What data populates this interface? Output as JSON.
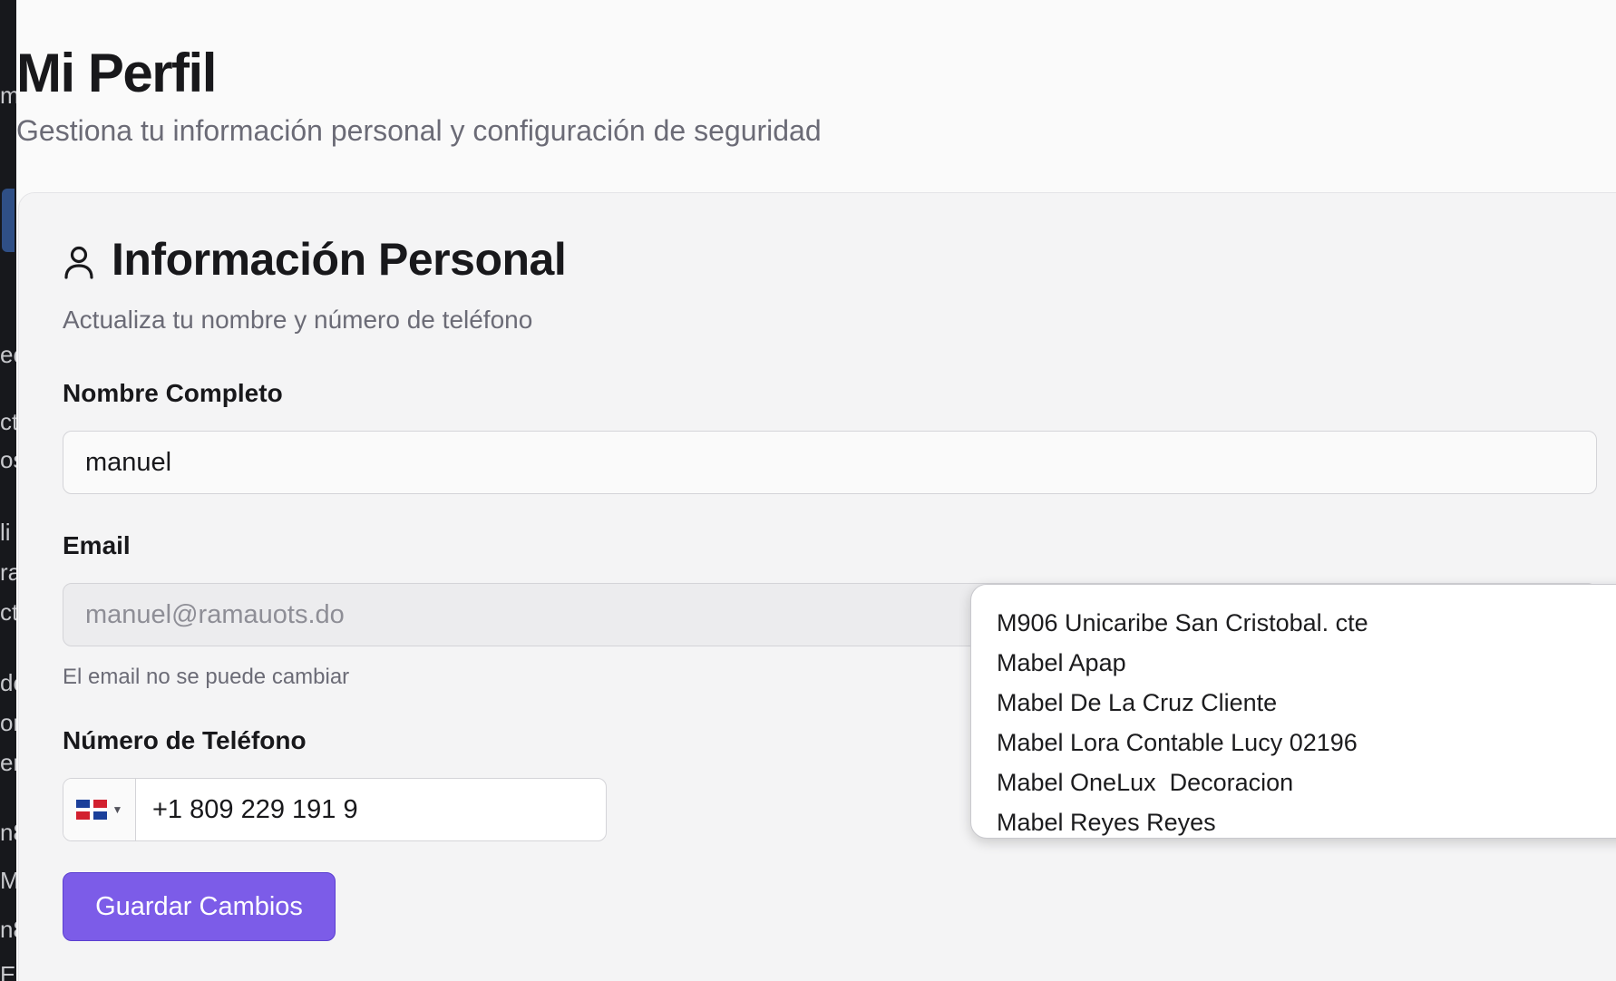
{
  "page": {
    "title": "Mi Perfil",
    "subtitle": "Gestiona tu información personal y configuración de seguridad"
  },
  "sidebar_fragments": [
    "m",
    "ec",
    "ct",
    "os",
    "li",
    "ra",
    "ct",
    "do",
    "or",
    "er",
    "n8",
    "Mi",
    "n8",
    "Er"
  ],
  "card": {
    "icon": "user-icon",
    "title": "Información Personal",
    "description": "Actualiza tu nombre y número de teléfono"
  },
  "form": {
    "name_label": "Nombre Completo",
    "name_value": "manuel",
    "email_label": "Email",
    "email_value": "manuel@ramauots.do",
    "email_help": "El email no se puede cambiar",
    "phone_label": "Número de Teléfono",
    "phone_value": "+1 809 229 191 9",
    "save_label": "Guardar Cambios"
  },
  "autocomplete": {
    "options": [
      "M906 Unicaribe San Cristobal. cte",
      "Mabel Apap",
      "Mabel De La Cruz Cliente",
      "Mabel Lora Contable Lucy 02196",
      "Mabel OneLux  Decoracion",
      "Mabel Reyes Reyes"
    ]
  },
  "colors": {
    "accent": "#7c5ce8",
    "sidebar": "#17181c"
  }
}
